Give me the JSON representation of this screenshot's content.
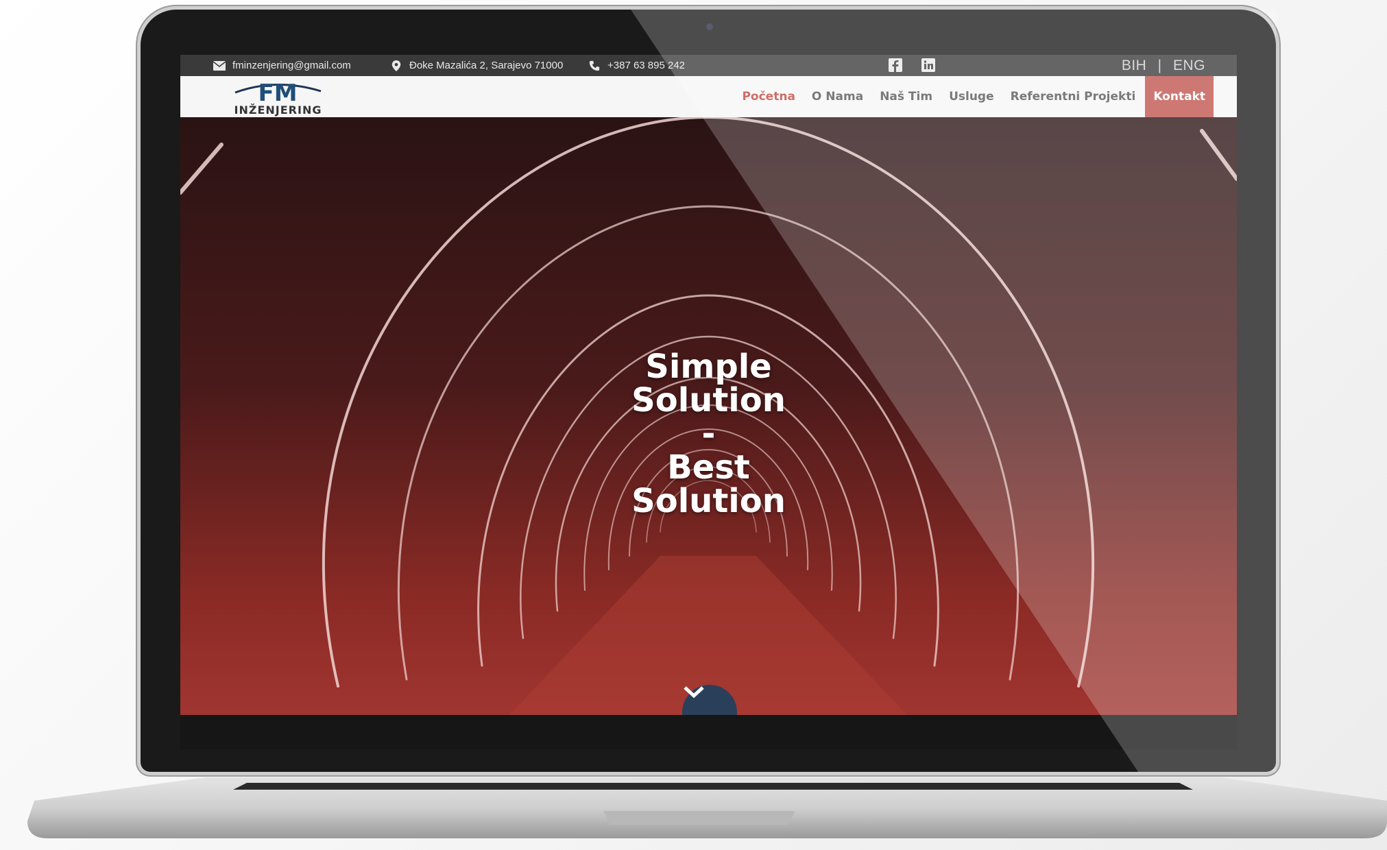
{
  "topbar": {
    "email": "fminzenjering@gmail.com",
    "address": "Đoke Mazalića 2, Sarajevo 71000",
    "phone": "+387 63 895 242",
    "social": [
      "facebook-icon",
      "linkedin-icon"
    ],
    "lang_bih": "BIH",
    "lang_sep": "|",
    "lang_eng": "ENG"
  },
  "header": {
    "logo_mark": "FM",
    "logo_text": "INŽENJERING",
    "nav": [
      {
        "label": "Početna",
        "active": true
      },
      {
        "label": "O Nama",
        "active": false
      },
      {
        "label": "Naš Tim",
        "active": false
      },
      {
        "label": "Usluge",
        "active": false
      },
      {
        "label": "Referentni Projekti",
        "active": false
      }
    ],
    "cta": "Kontakt"
  },
  "hero": {
    "line1": "Simple",
    "line2": "Solution",
    "line3": "-",
    "line4": "Best",
    "line5": "Solution"
  },
  "colors": {
    "accent": "#c0524c",
    "active_nav": "#c0453d",
    "scroll_button": "#2a3f5a"
  }
}
